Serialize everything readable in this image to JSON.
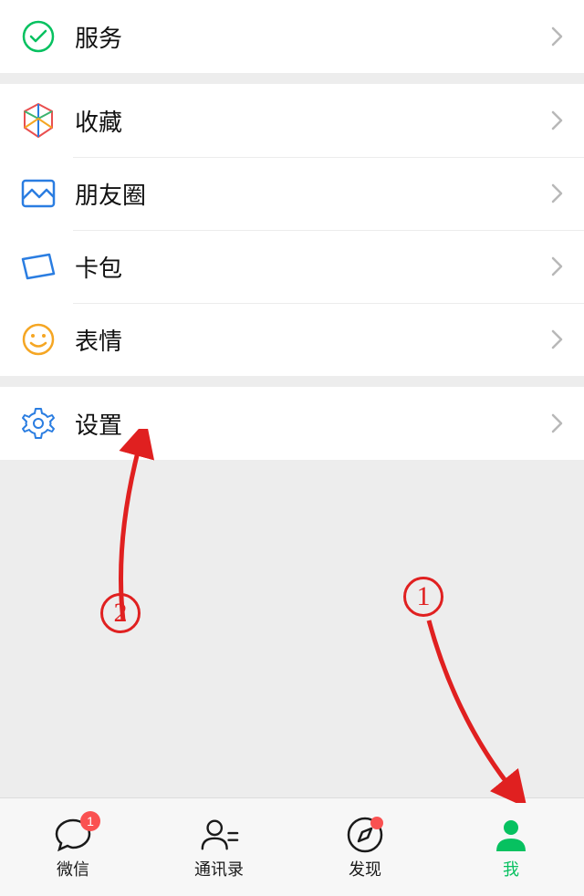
{
  "sections": [
    {
      "items": [
        {
          "icon": "service",
          "label": "服务"
        }
      ]
    },
    {
      "items": [
        {
          "icon": "favorites",
          "label": "收藏"
        },
        {
          "icon": "moments",
          "label": "朋友圈"
        },
        {
          "icon": "cards",
          "label": "卡包"
        },
        {
          "icon": "stickers",
          "label": "表情"
        }
      ]
    },
    {
      "items": [
        {
          "icon": "settings",
          "label": "设置"
        }
      ]
    }
  ],
  "tabs": [
    {
      "icon": "chat",
      "label": "微信",
      "badge_num": "1"
    },
    {
      "icon": "contacts",
      "label": "通讯录"
    },
    {
      "icon": "discover",
      "label": "发现",
      "badge_dot": true
    },
    {
      "icon": "me",
      "label": "我",
      "active": true
    }
  ],
  "annotations": {
    "n1": "1",
    "n2": "2"
  }
}
